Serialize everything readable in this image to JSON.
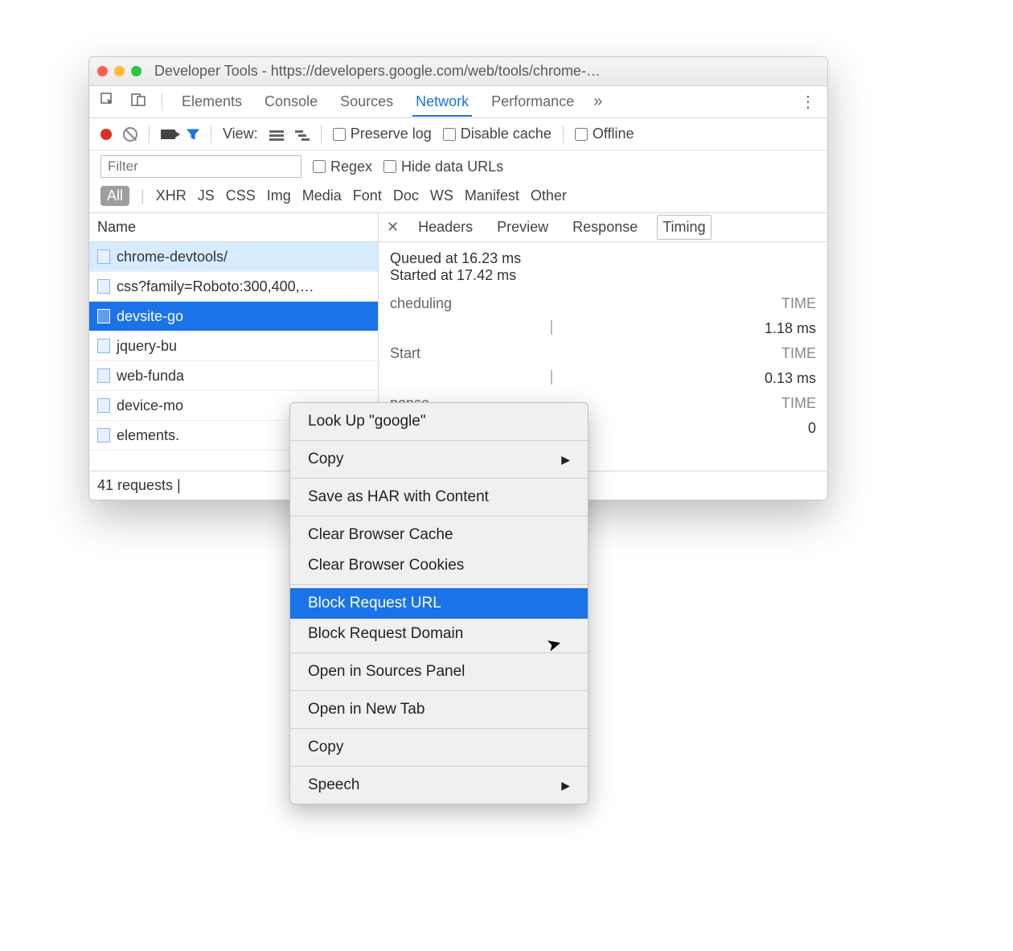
{
  "window": {
    "title": "Developer Tools - https://developers.google.com/web/tools/chrome-…"
  },
  "main_tabs": {
    "t0": "Elements",
    "t1": "Console",
    "t2": "Sources",
    "t3": "Network",
    "t4": "Performance",
    "active": "Network"
  },
  "toolbar": {
    "view_label": "View:",
    "preserve_label": "Preserve log",
    "disable_label": "Disable cache",
    "offline_label": "Offline"
  },
  "filter": {
    "placeholder": "Filter",
    "regex_label": "Regex",
    "hide_label": "Hide data URLs"
  },
  "types": {
    "all": "All",
    "xhr": "XHR",
    "js": "JS",
    "css": "CSS",
    "img": "Img",
    "media": "Media",
    "font": "Font",
    "doc": "Doc",
    "ws": "WS",
    "manifest": "Manifest",
    "other": "Other"
  },
  "network": {
    "name_header": "Name",
    "rows": [
      {
        "name": "chrome-devtools/"
      },
      {
        "name": "css?family=Roboto:300,400,…"
      },
      {
        "name": "devsite-go"
      },
      {
        "name": "jquery-bu"
      },
      {
        "name": "web-funda"
      },
      {
        "name": "device-mo"
      },
      {
        "name": "elements."
      }
    ],
    "selected_index": 2,
    "highlighted_top_index": 0
  },
  "detail": {
    "tabs": {
      "headers": "Headers",
      "preview": "Preview",
      "response": "Response",
      "timing": "Timing"
    },
    "active": "Timing",
    "timing": {
      "queued": "Queued at 16.23 ms",
      "started": "Started at 17.42 ms",
      "sections": [
        {
          "label": "cheduling",
          "time_caption": "TIME",
          "value": "1.18 ms"
        },
        {
          "label": "Start",
          "time_caption": "TIME",
          "value": "0.13 ms"
        },
        {
          "label": "ponse",
          "time_caption": "TIME",
          "value": "0"
        }
      ]
    }
  },
  "status": {
    "text": "41 requests |"
  },
  "context_menu": {
    "items": [
      {
        "label": "Look Up \"google\""
      },
      {
        "sep": true
      },
      {
        "label": "Copy",
        "submenu": true
      },
      {
        "sep": true
      },
      {
        "label": "Save as HAR with Content"
      },
      {
        "sep": true
      },
      {
        "label": "Clear Browser Cache"
      },
      {
        "label": "Clear Browser Cookies"
      },
      {
        "sep": true
      },
      {
        "label": "Block Request URL",
        "highlight": true
      },
      {
        "label": "Block Request Domain"
      },
      {
        "sep": true
      },
      {
        "label": "Open in Sources Panel"
      },
      {
        "sep": true
      },
      {
        "label": "Open in New Tab"
      },
      {
        "sep": true
      },
      {
        "label": "Copy"
      },
      {
        "sep": true
      },
      {
        "label": "Speech",
        "submenu": true
      }
    ]
  }
}
